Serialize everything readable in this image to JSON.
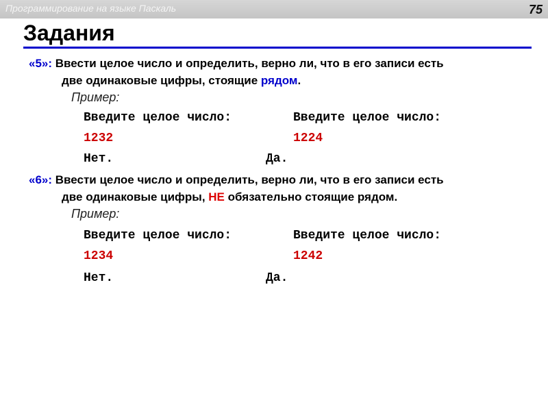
{
  "header": {
    "title": "Программирование на языке Паскаль",
    "page_number": "75"
  },
  "slide": {
    "title": "Задания"
  },
  "tasks": [
    {
      "number": "«5»:",
      "line1": " Ввести целое число и определить, верно ли, что в его записи есть",
      "line2_before": "две одинаковые цифры, стоящие ",
      "line2_highlight": "рядом",
      "line2_after": ".",
      "example_label": "Пример:",
      "examples": [
        {
          "prompt": "Введите целое число:",
          "input": "1232",
          "result": "Нет."
        },
        {
          "prompt": "Введите целое число:",
          "input": "1224",
          "result": "Да."
        }
      ]
    },
    {
      "number": "«6»:",
      "line1": " Ввести целое число и определить, верно ли, что в его записи есть",
      "line2_before": "две одинаковые цифры, ",
      "line2_highlight": "НЕ",
      "line2_after": " обязательно стоящие рядом.",
      "example_label": "Пример:",
      "examples": [
        {
          "prompt": "Введите целое число:",
          "input": "1234",
          "result": "Нет."
        },
        {
          "prompt": "Введите целое число:",
          "input": "1242",
          "result": "Да."
        }
      ]
    }
  ],
  "colors": {
    "accent_blue": "#0000cc",
    "highlight_red": "#dd0000",
    "header_bg": "#cccccc"
  }
}
